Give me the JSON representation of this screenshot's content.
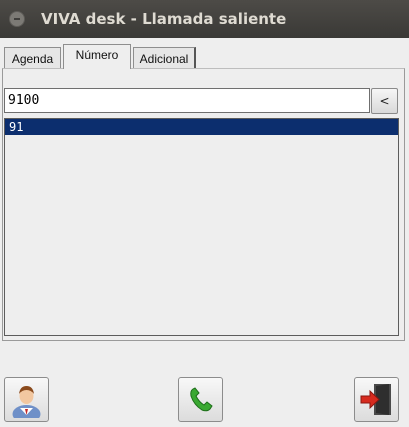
{
  "window": {
    "title": "VIVA desk - Llamada saliente"
  },
  "tabs": [
    {
      "label": "Agenda"
    },
    {
      "label": "Número"
    },
    {
      "label": "Adicional"
    }
  ],
  "number_input": {
    "value": "9100"
  },
  "backspace_button": {
    "label": "<"
  },
  "results": [
    {
      "text": "91"
    }
  ],
  "buttons": {
    "contact_icon": "person-icon",
    "call_icon": "phone-call-icon",
    "exit_icon": "exit-door-icon"
  },
  "colors": {
    "titlebar": "#3f3e3b",
    "selection": "#0c2e6e",
    "call_green": "#3aa832",
    "exit_red": "#d62a1e"
  }
}
